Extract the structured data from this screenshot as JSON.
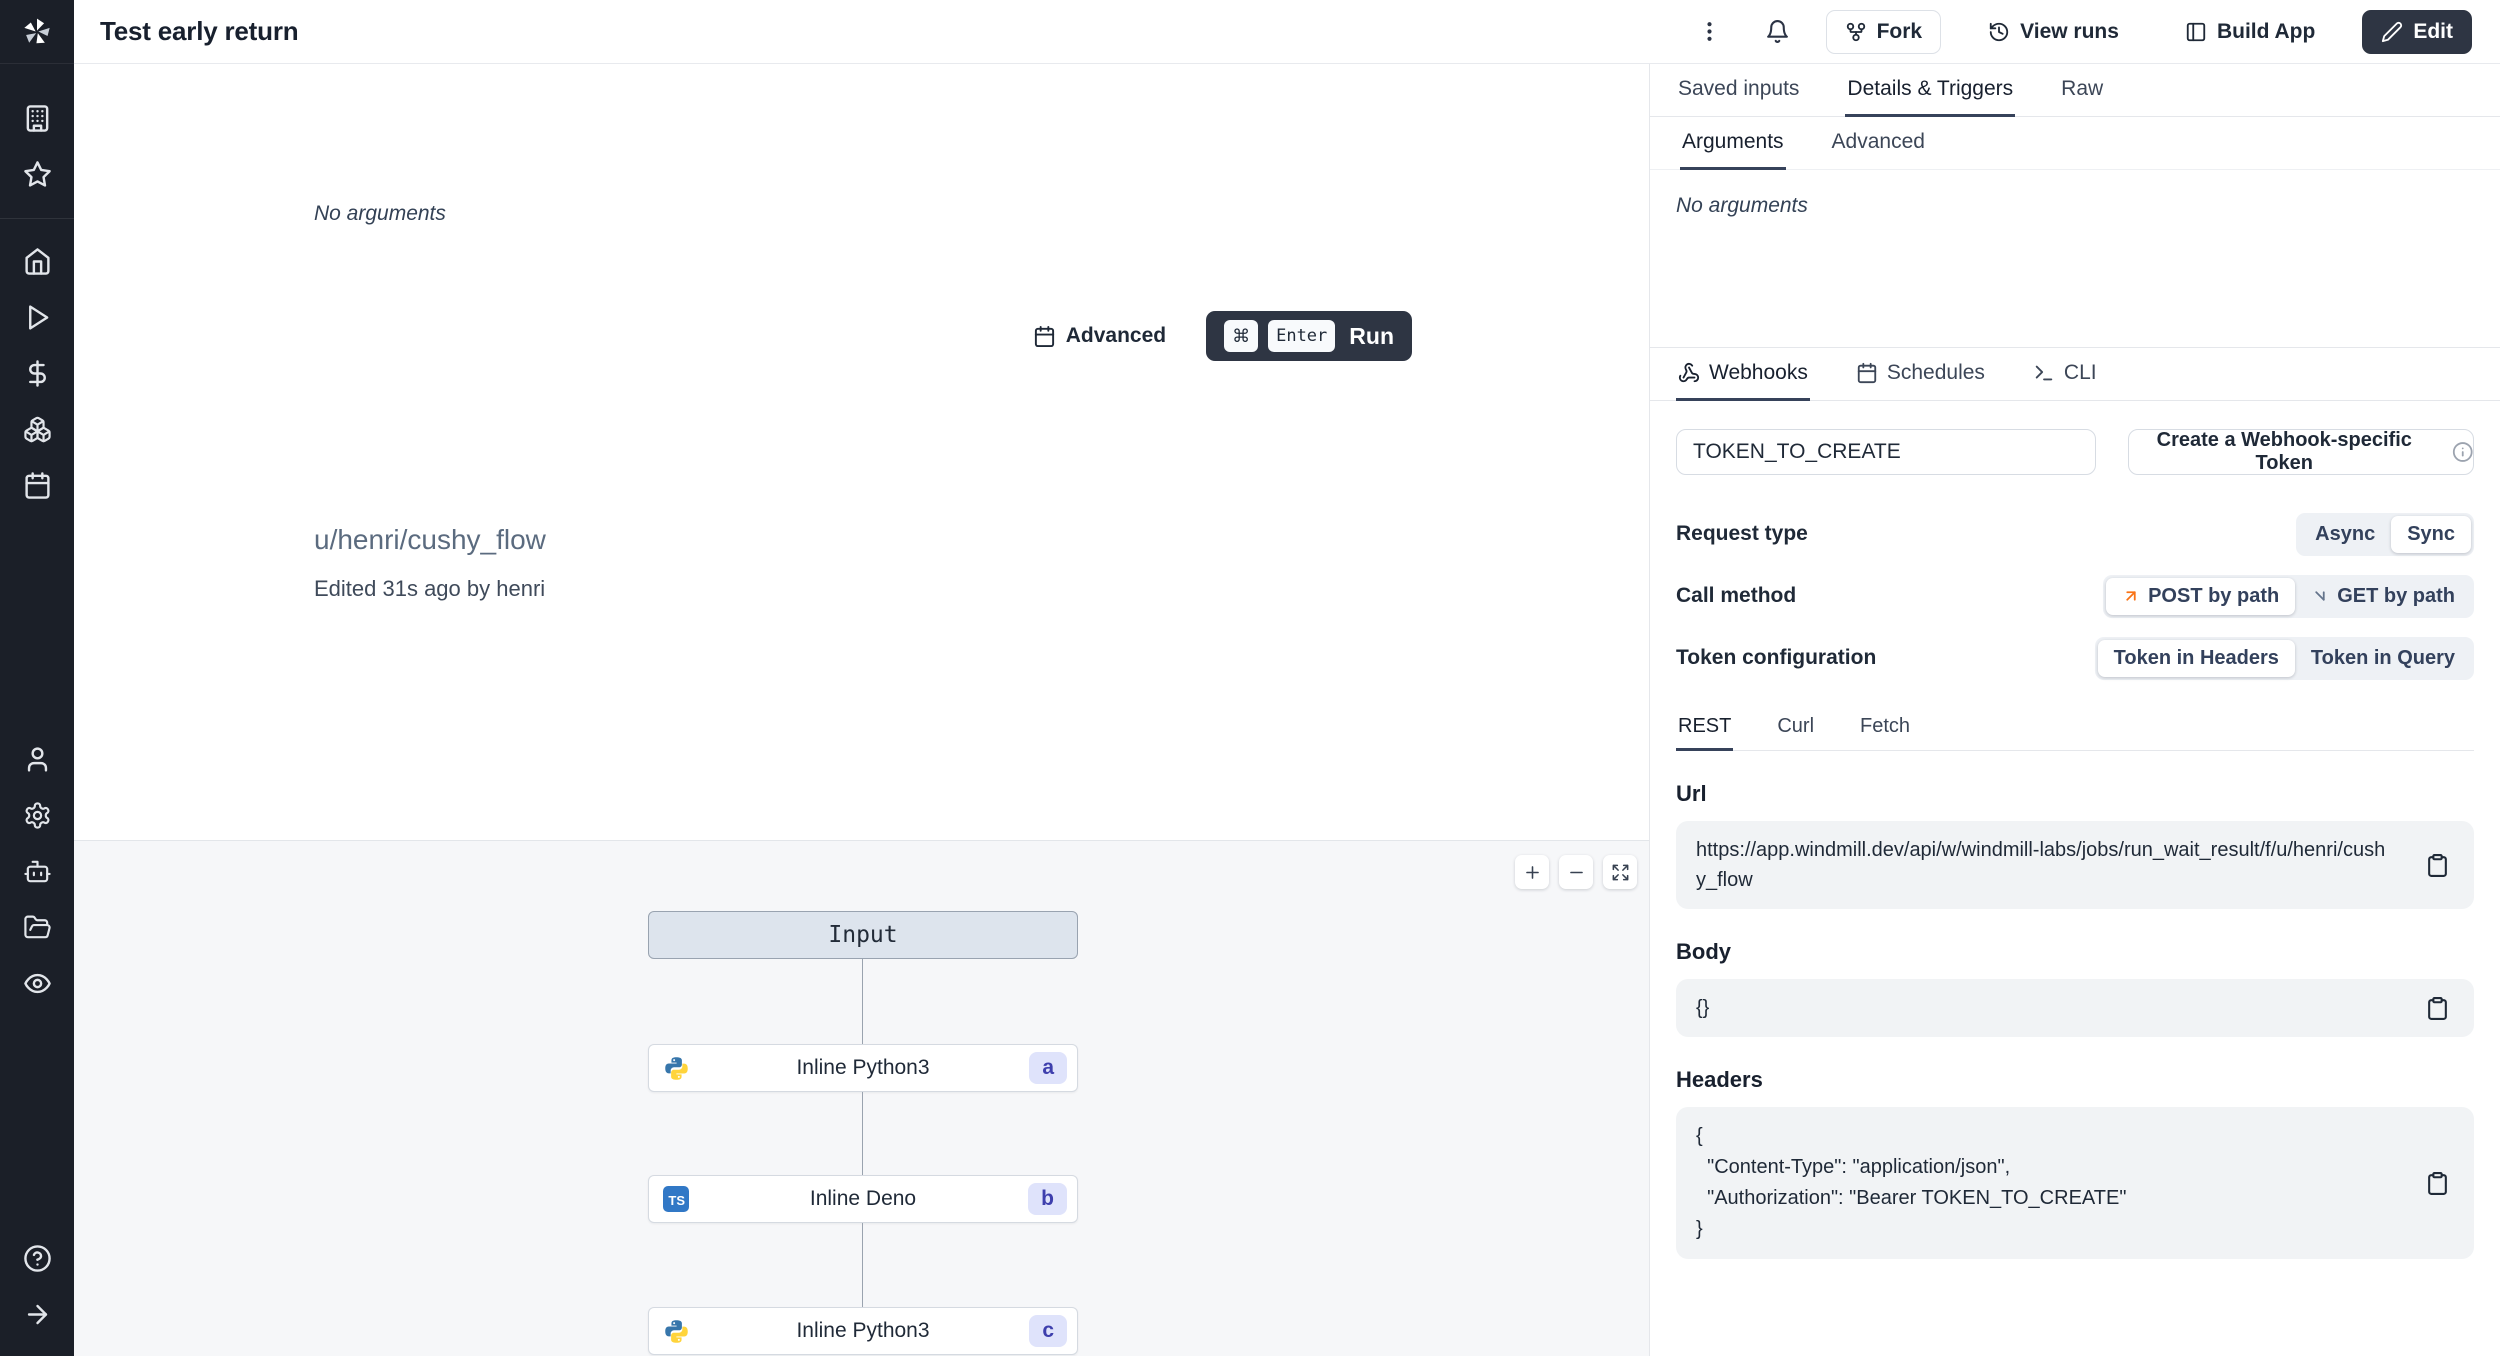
{
  "topbar": {
    "title": "Test early return",
    "fork_label": "Fork",
    "view_runs_label": "View runs",
    "build_app_label": "Build App",
    "edit_label": "Edit"
  },
  "run_pane": {
    "no_arguments": "No arguments",
    "advanced_label": "Advanced",
    "cmd_key": "⌘",
    "enter_key": "Enter",
    "run_label": "Run",
    "flow_path": "u/henri/cushy_flow",
    "edited_info": "Edited 31s ago by henri"
  },
  "canvas": {
    "input_label": "Input",
    "nodes": [
      {
        "label": "Inline Python3",
        "badge": "a",
        "lang": "python3"
      },
      {
        "label": "Inline Deno",
        "badge": "b",
        "lang": "deno"
      },
      {
        "label": "Inline Python3",
        "badge": "c",
        "lang": "python3"
      }
    ],
    "ts_icon_text": "TS"
  },
  "panel": {
    "tabs": {
      "saved_inputs": "Saved inputs",
      "details_triggers": "Details & Triggers",
      "raw": "Raw"
    },
    "subtabs": {
      "arguments": "Arguments",
      "advanced": "Advanced"
    },
    "no_arguments": "No arguments",
    "trigger_tabs": {
      "webhooks": "Webhooks",
      "schedules": "Schedules",
      "cli": "CLI"
    },
    "webhook": {
      "token_value": "TOKEN_TO_CREATE",
      "create_token_label": "Create a Webhook-specific Token",
      "request_type_label": "Request type",
      "async_label": "Async",
      "sync_label": "Sync",
      "call_method_label": "Call method",
      "post_label": "POST by path",
      "get_label": "GET by path",
      "token_config_label": "Token configuration",
      "token_headers_label": "Token in Headers",
      "token_query_label": "Token in Query",
      "code_tabs": {
        "rest": "REST",
        "curl": "Curl",
        "fetch": "Fetch"
      },
      "url_label": "Url",
      "url_value": "https://app.windmill.dev/api/w/windmill-labs/jobs/run_wait_result/f/u/henri/cushy_flow",
      "body_label": "Body",
      "body_value": "{}",
      "headers_label": "Headers",
      "headers_value": "{\n  \"Content-Type\": \"application/json\",\n  \"Authorization\": \"Bearer TOKEN_TO_CREATE\"\n}"
    }
  },
  "icons": [
    "windmill-logo",
    "building-icon",
    "star-icon",
    "home-icon",
    "play-icon",
    "dollar-icon",
    "boxes-icon",
    "calendar-icon",
    "user-icon",
    "gear-icon",
    "bot-icon",
    "folder-icon",
    "eye-icon",
    "help-icon",
    "arrow-right-icon",
    "kebab-icon",
    "bell-icon",
    "fork-icon",
    "history-icon",
    "panel-icon",
    "pencil-icon",
    "plus-icon",
    "minus-icon",
    "expand-icon",
    "webhook-icon",
    "terminal-icon",
    "info-icon",
    "clipboard-icon",
    "arrow-up-right-icon",
    "arrow-down-right-icon",
    "python-icon",
    "typescript-icon"
  ],
  "colors": {
    "sidebar_bg": "#1b1f28",
    "dark_button": "#2e3543",
    "accent_underline": "#36425a",
    "badge_bg": "#dfe3fb",
    "badge_text": "#3e3fad",
    "orange_arrow": "#f97316",
    "canvas_bg": "#f6f7f9",
    "input_node_bg": "#dde4ed",
    "python_blue": "#3776ab",
    "python_yellow": "#ffd43b",
    "ts_blue": "#3178c6"
  }
}
